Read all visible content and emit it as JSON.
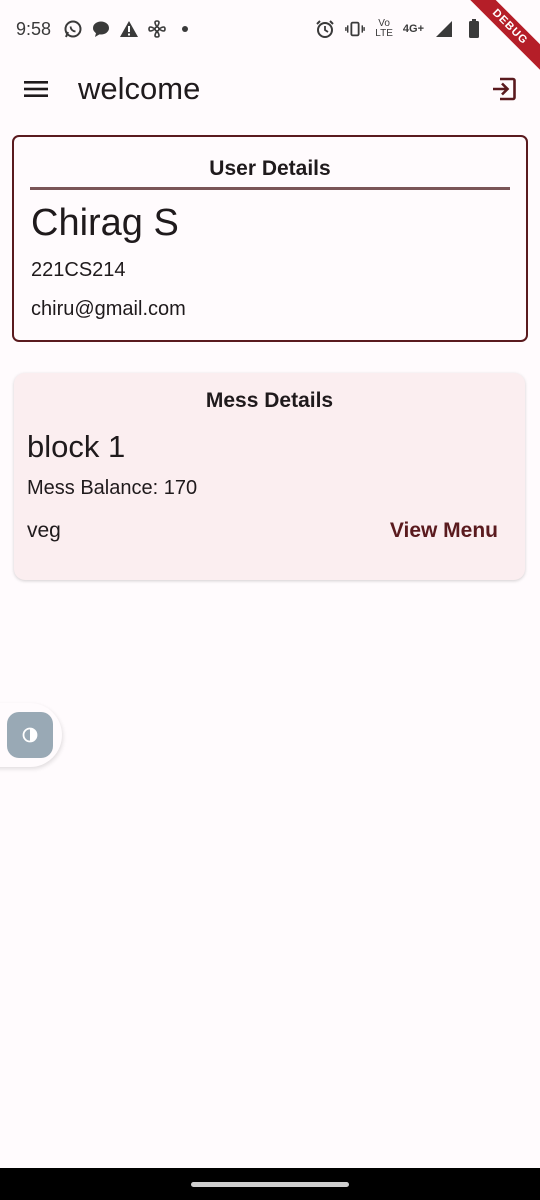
{
  "status_bar": {
    "time": "9:58",
    "left_icons": [
      "whatsapp-icon",
      "chat-icon",
      "warning-icon",
      "pinwheel-icon",
      "dot-icon"
    ],
    "right_icons": [
      "alarm-icon",
      "vibrate-icon",
      "volte-icon",
      "signal-icon",
      "battery-icon"
    ],
    "volte_top": "Vo",
    "volte_bottom": "LTE",
    "network": "4G+",
    "debug_banner": "DEBUG"
  },
  "app_bar": {
    "title": "welcome",
    "menu_icon": "hamburger-menu-icon",
    "logout_icon": "logout-icon"
  },
  "user_card": {
    "heading": "User Details",
    "name": "Chirag S",
    "roll_number": "221CS214",
    "email": "chiru@gmail.com"
  },
  "mess_card": {
    "heading": "Mess Details",
    "block": "block 1",
    "balance": "Mess Balance: 170",
    "food_type": "veg",
    "view_menu_label": "View Menu"
  },
  "theme_toggle": {
    "icon": "contrast-icon"
  },
  "colors": {
    "accent": "#5a1a1e",
    "background": "#fffbfd",
    "mess_card_bg": "#fbeef0",
    "toggle_bg": "#99a9b5",
    "debug_ribbon": "#b51e28"
  }
}
